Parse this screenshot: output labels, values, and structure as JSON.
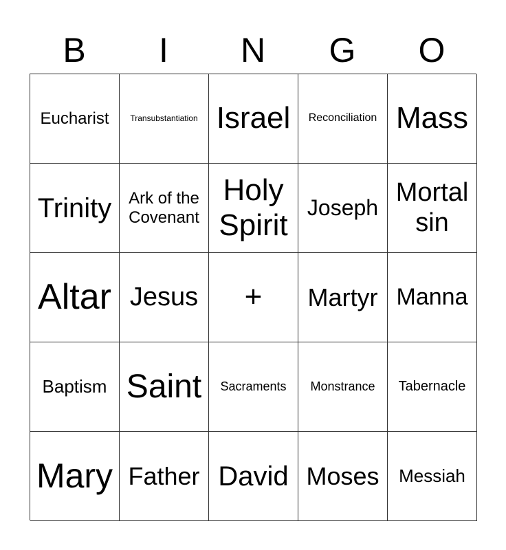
{
  "header": [
    "B",
    "I",
    "N",
    "G",
    "O"
  ],
  "cells": [
    {
      "text": "Eucharist",
      "size": 24
    },
    {
      "text": "Transubstantiation",
      "size": 12
    },
    {
      "text": "Israel",
      "size": 44
    },
    {
      "text": "Reconciliation",
      "size": 16
    },
    {
      "text": "Mass",
      "size": 44
    },
    {
      "text": "Trinity",
      "size": 40
    },
    {
      "text": "Ark of the Covenant",
      "size": 24
    },
    {
      "text": "Holy Spirit",
      "size": 44
    },
    {
      "text": "Joseph",
      "size": 32
    },
    {
      "text": "Mortal sin",
      "size": 38
    },
    {
      "text": "Altar",
      "size": 52
    },
    {
      "text": "Jesus",
      "size": 38
    },
    {
      "text": "+",
      "size": 44
    },
    {
      "text": "Martyr",
      "size": 36
    },
    {
      "text": "Manna",
      "size": 34
    },
    {
      "text": "Baptism",
      "size": 26
    },
    {
      "text": "Saint",
      "size": 48
    },
    {
      "text": "Sacraments",
      "size": 18
    },
    {
      "text": "Monstrance",
      "size": 18
    },
    {
      "text": "Tabernacle",
      "size": 20
    },
    {
      "text": "Mary",
      "size": 50
    },
    {
      "text": "Father",
      "size": 36
    },
    {
      "text": "David",
      "size": 40
    },
    {
      "text": "Moses",
      "size": 36
    },
    {
      "text": "Messiah",
      "size": 26
    }
  ]
}
